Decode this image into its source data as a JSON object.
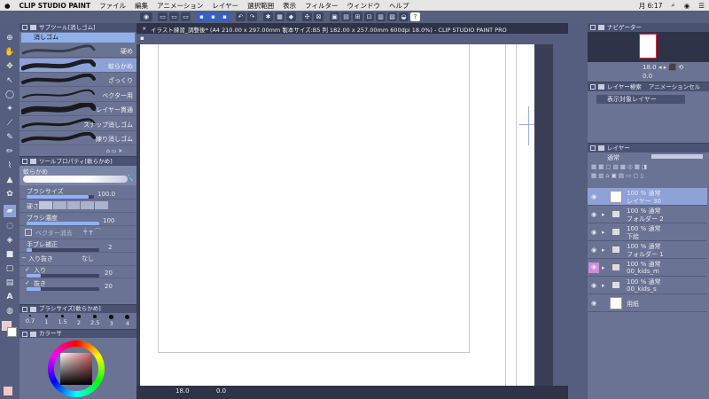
{
  "menubar": {
    "app": "CLIP STUDIO PAINT",
    "items": [
      "ファイル",
      "編集",
      "アニメーション",
      "レイヤー",
      "選択範囲",
      "表示",
      "フィルター",
      "ウィンドウ",
      "ヘルプ"
    ],
    "time": "月 6:17"
  },
  "document": {
    "tab": "イラスト練習_調整後* (A4 210.00 x 297.00mm 製本サイズ:B5 判 182.00 x 257.00mm 600dpi 18.0%) - CLIP STUDIO PAINT PRO",
    "zoom": "18.0",
    "tab_close": "×"
  },
  "subtool": {
    "title": "サブツール[消しゴム]",
    "active_group": "消しゴム",
    "items": [
      "硬め",
      "軟らかめ",
      "ざっくり",
      "ベクター用",
      "レイヤー貫通",
      "スナップ消しゴム",
      "練り消しゴム"
    ]
  },
  "toolprop": {
    "title": "ツールプロパティ[軟らかめ]",
    "name": "軟らかめ",
    "brush_size_label": "ブラシサイズ",
    "brush_size": "100.0",
    "hardness_label": "硬さ",
    "density_label": "ブラシ濃度",
    "density": "100",
    "vector_erase": "ベクター消去",
    "stabilize_label": "手ブレ補正",
    "stabilize": "2",
    "taper_label": "入り抜き",
    "taper_value": "なし",
    "in_label": "入り",
    "in_value": "20",
    "out_label": "抜き",
    "out_value": "20"
  },
  "brushsize": {
    "title": "ブラシサイズ[軟らかめ]",
    "values": [
      "0.7",
      "1",
      "1.5",
      "2",
      "2.5",
      "3",
      "4"
    ]
  },
  "color": {
    "title": "カラーサ",
    "fg": "#f2c8c8",
    "bg": "#ffffff",
    "hue_color": "#f2b7b7"
  },
  "navigator": {
    "title": "ナビゲーター",
    "zoom": "18.0",
    "angle": "0.0"
  },
  "layer_search": {
    "tab": "レイヤー検索",
    "tab2": "アニメーションセル",
    "label": "表示対象レイヤー"
  },
  "layers": {
    "title": "レイヤー",
    "blend": "通常",
    "opacity": "100",
    "items": [
      {
        "pct": "100 % 通常",
        "name": "レイヤー 30",
        "type": "raster"
      },
      {
        "pct": "100 % 通常",
        "name": "フォルダー 2",
        "type": "folder"
      },
      {
        "pct": "100 % 通常",
        "name": "下絵",
        "type": "folder"
      },
      {
        "pct": "100 % 通常",
        "name": "フォルダー 1",
        "type": "folder"
      },
      {
        "pct": "100 % 通常",
        "name": "00_kids_m",
        "type": "folder"
      },
      {
        "pct": "100 % 通常",
        "name": "00_kids_s",
        "type": "folder"
      },
      {
        "pct": "",
        "name": "用紙",
        "type": "paper"
      }
    ]
  },
  "statusbar": {
    "zoom": "18.0",
    "angle": "0.0"
  }
}
